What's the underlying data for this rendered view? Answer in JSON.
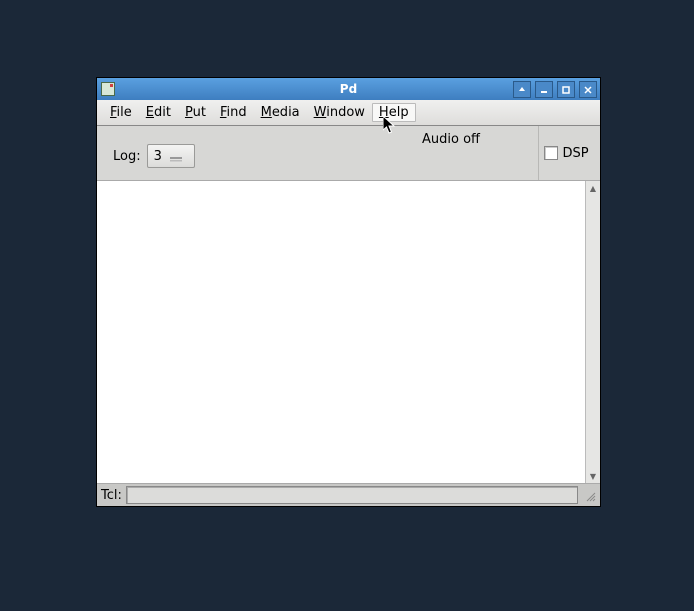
{
  "window": {
    "title": "Pd",
    "icon_text": "Pd"
  },
  "menubar": {
    "items": [
      {
        "accel": "F",
        "rest": "ile"
      },
      {
        "accel": "E",
        "rest": "dit"
      },
      {
        "accel": "P",
        "rest": "ut"
      },
      {
        "accel": "F",
        "rest": "ind"
      },
      {
        "accel": "M",
        "rest": "edia"
      },
      {
        "accel": "W",
        "rest": "indow"
      },
      {
        "accel": "H",
        "rest": "elp"
      }
    ]
  },
  "toolbar": {
    "log_label": "Log:",
    "log_value": "3",
    "audio_status": "Audio off",
    "dsp_label": "DSP",
    "dsp_checked": false
  },
  "console": {
    "text": ""
  },
  "statusbar": {
    "tcl_label": "Tcl:",
    "tcl_value": ""
  }
}
